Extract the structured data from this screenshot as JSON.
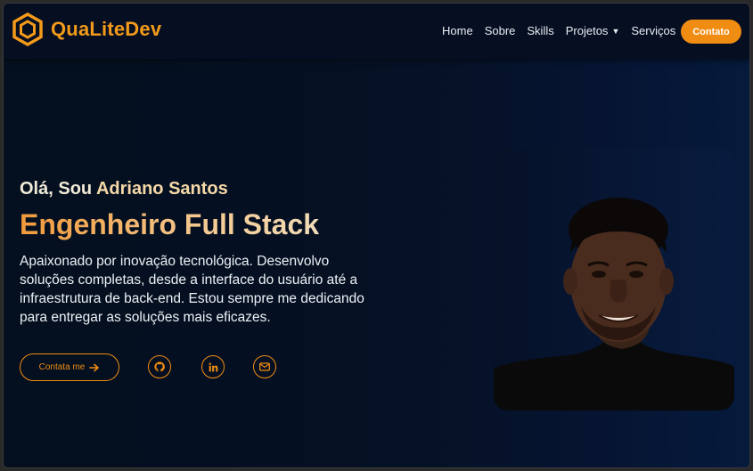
{
  "brand": {
    "name": "QuaLiteDev",
    "accent": "#f08c12"
  },
  "nav": {
    "items": [
      {
        "label": "Home"
      },
      {
        "label": "Sobre"
      },
      {
        "label": "Skills"
      },
      {
        "label": "Projetos"
      },
      {
        "label": "Serviços"
      }
    ],
    "cta_label": "Contato"
  },
  "hero": {
    "greeting_prefix": "Olá, Sou",
    "greeting_name": "Adriano Santos",
    "role": "Engenheiro Full Stack",
    "description": "Apaixonado por inovação tecnológica. Desenvolvo soluções completas, desde a interface do usuário até a infraestrutura de back-end. Estou sempre me dedicando para entregar as soluções mais eficazes.",
    "contact_button": "Contata me",
    "social_icons": [
      "github-icon",
      "linkedin-icon",
      "email-icon"
    ]
  }
}
